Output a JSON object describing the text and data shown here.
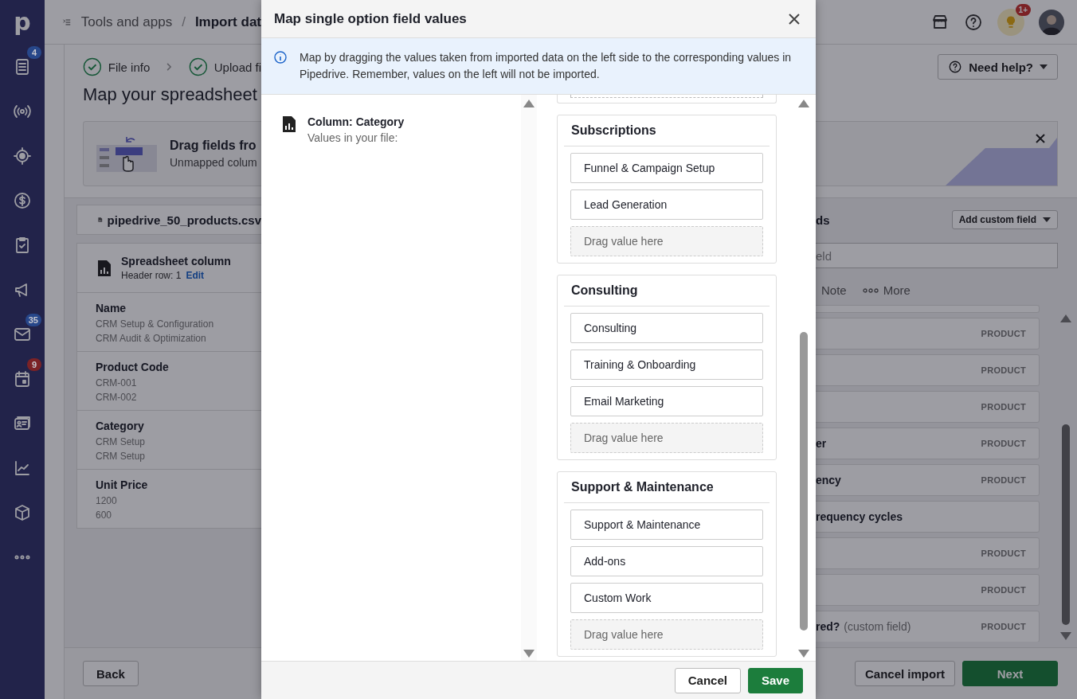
{
  "sidebar": {
    "logo": "p",
    "items": [
      {
        "kind": "deals",
        "badge": {
          "text": "4",
          "color": "#27478a"
        }
      },
      {
        "kind": "broadcast"
      },
      {
        "kind": "target"
      },
      {
        "kind": "dollar"
      },
      {
        "kind": "tasks"
      },
      {
        "kind": "megaphone"
      },
      {
        "kind": "mail",
        "badge": {
          "text": "35",
          "color": "#27478a"
        }
      },
      {
        "kind": "calendar",
        "badge": {
          "text": "9",
          "color": "#7b2226"
        }
      },
      {
        "kind": "contacts"
      },
      {
        "kind": "chart"
      },
      {
        "kind": "box"
      },
      {
        "kind": "more"
      }
    ]
  },
  "topbar": {
    "breadcrumb": [
      "Tools and apps",
      "Import dat"
    ],
    "separator": "/",
    "notification_badge": "1+"
  },
  "steps": [
    {
      "label": "File info",
      "done": true
    },
    {
      "label": "Upload fi",
      "done": true
    }
  ],
  "title": "Map your spreadsheet",
  "banner": {
    "title": "Drag fields fro",
    "subtitle": "Unmapped colum"
  },
  "file": {
    "name": "pipedrive_50_products.csv"
  },
  "columns_card": {
    "title": "Spreadsheet column",
    "header_row": "Header row: 1",
    "edit": "Edit",
    "rows": [
      {
        "name": "Name",
        "samples": [
          "CRM Setup & Configuration",
          "CRM Audit & Optimization"
        ]
      },
      {
        "name": "Product Code",
        "samples": [
          "CRM-001",
          "CRM-002"
        ]
      },
      {
        "name": "Category",
        "samples": [
          "CRM Setup",
          "CRM Setup"
        ]
      },
      {
        "name": "Unit Price",
        "samples": [
          "1200",
          "600"
        ]
      }
    ]
  },
  "back_button": "Back",
  "right_panel": {
    "help_button": "Need help?",
    "fields_heading": "ds",
    "add_field_button": "Add custom field",
    "search": {
      "placeholder": "eld"
    },
    "tabs": [
      {
        "label": "Note",
        "kind": "plain"
      },
      {
        "label": "More",
        "kind": "more"
      }
    ],
    "field_rows": [
      {
        "tag": "PRODUCT"
      },
      {
        "tag": "PRODUCT"
      },
      {
        "tag": "PRODUCT"
      },
      {
        "title": "er",
        "tag": "PRODUCT"
      },
      {
        "title": "ency",
        "tag": "PRODUCT"
      },
      {
        "title": "requency cycles"
      },
      {
        "tag": "PRODUCT"
      },
      {
        "tag": "PRODUCT"
      },
      {
        "title": "red?",
        "note": "(custom field)",
        "tag": "PRODUCT"
      }
    ],
    "cancel_button": "Cancel import",
    "next_button": "Next"
  },
  "modal": {
    "title": "Map single option field values",
    "info": "Map by dragging the values taken from imported data on the left side to the corresponding values in Pipedrive. Remember, values on the left will not be imported.",
    "source": {
      "heading": "Column: Category",
      "subheading": "Values in your file:"
    },
    "groups": [
      {
        "name": "Subscriptions",
        "values": [
          {
            "label": "Funnel & Campaign Setup",
            "kind": "value"
          },
          {
            "label": "Lead Generation",
            "kind": "value"
          },
          {
            "label": "Drag value here",
            "kind": "drop"
          }
        ]
      },
      {
        "name": "Consulting",
        "values": [
          {
            "label": "Consulting",
            "kind": "value"
          },
          {
            "label": "Training & Onboarding",
            "kind": "value"
          },
          {
            "label": "Email Marketing",
            "kind": "value"
          },
          {
            "label": "Drag value here",
            "kind": "drop"
          }
        ]
      },
      {
        "name": "Support & Maintenance",
        "values": [
          {
            "label": "Support & Maintenance",
            "kind": "value"
          },
          {
            "label": "Add-ons",
            "kind": "value"
          },
          {
            "label": "Custom Work",
            "kind": "value"
          },
          {
            "label": "Drag value here",
            "kind": "drop"
          }
        ]
      }
    ],
    "buttons": [
      {
        "label": "Cancel",
        "kind": "secondary"
      },
      {
        "label": "Save",
        "kind": "primary"
      }
    ]
  }
}
